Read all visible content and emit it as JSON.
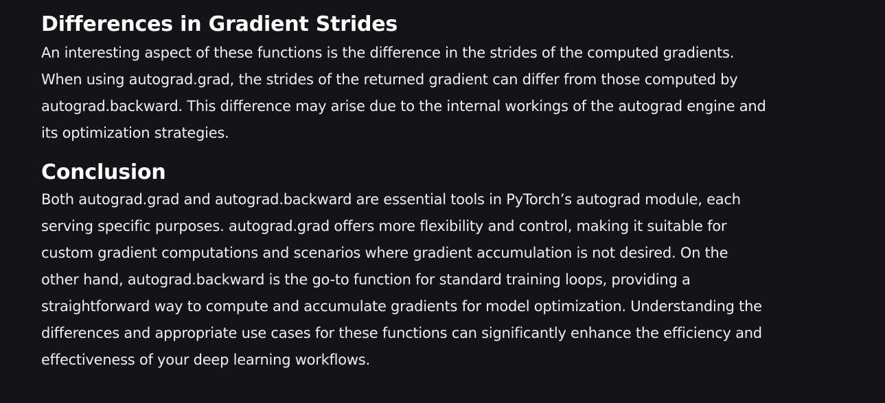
{
  "sections": [
    {
      "title": "Differences in Gradient Strides",
      "body": "An interesting aspect of these functions is the difference in the strides of the computed gradients. When using autograd.grad, the strides of the returned gradient can differ from those computed by autograd.backward. This difference may arise due to the internal workings of the autograd engine and its optimization strategies."
    },
    {
      "title": "Conclusion",
      "body": "Both autograd.grad and autograd.backward are essential tools in PyTorch’s autograd module, each serving specific purposes. autograd.grad offers more flexibility and control, making it suitable for custom gradient computations and scenarios where gradient accumulation is not desired. On the other hand, autograd.backward is the go-to function for standard training loops, providing a straightforward way to compute and accumulate gradients for model optimization. Understanding the differences and appropriate use cases for these functions can significantly enhance the efficiency and effectiveness of your deep learning workflows."
    }
  ],
  "colors": {
    "background": "#131417",
    "heading": "#ffffff",
    "text": "#f0f0f0"
  }
}
